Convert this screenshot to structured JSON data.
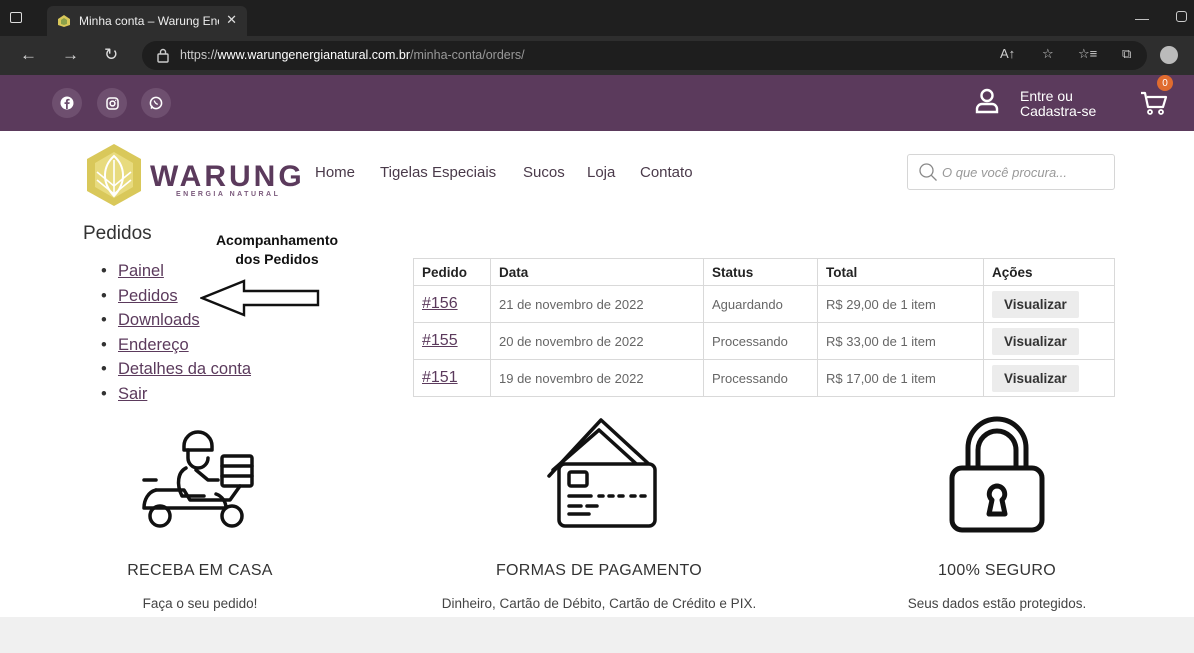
{
  "browser": {
    "tab_title": "Minha conta – Warung Energia N",
    "url_scheme": "https://",
    "url_host": "www.warungenergianatural.com.br",
    "url_path": "/minha-conta/orders/"
  },
  "topbar": {
    "account_line1": "Entre ou",
    "account_line2": "Cadastra-se",
    "cart_count": "0"
  },
  "brand": {
    "name": "WARUNG",
    "tagline": "ENERGIA NATURAL"
  },
  "nav": {
    "items": [
      "Home",
      "Tigelas Especiais",
      "Sucos",
      "Loja",
      "Contato"
    ]
  },
  "search": {
    "placeholder": "O que você procura..."
  },
  "account": {
    "section_title": "Pedidos",
    "annotation_line1": "Acompanhamento",
    "annotation_line2": "dos Pedidos",
    "menu": [
      "Painel",
      "Pedidos",
      "Downloads",
      "Endereço",
      "Detalhes da conta",
      "Sair"
    ]
  },
  "orders": {
    "headers": [
      "Pedido",
      "Data",
      "Status",
      "Total",
      "Ações"
    ],
    "rows": [
      {
        "number": "#156",
        "date": "21 de novembro de 2022",
        "status": "Aguardando",
        "total": "R$ 29,00 de 1 item",
        "action": "Visualizar"
      },
      {
        "number": "#155",
        "date": "20 de novembro de 2022",
        "status": "Processando",
        "total": "R$ 33,00 de 1 item",
        "action": "Visualizar"
      },
      {
        "number": "#151",
        "date": "19 de novembro de 2022",
        "status": "Processando",
        "total": "R$ 17,00 de 1 item",
        "action": "Visualizar"
      }
    ]
  },
  "features": [
    {
      "title": "RECEBA EM CASA",
      "desc": "Faça o seu pedido!",
      "icon": "delivery-scooter-icon"
    },
    {
      "title": "FORMAS DE PAGAMENTO",
      "desc": "Dinheiro, Cartão de Débito, Cartão de Crédito e PIX.",
      "icon": "credit-card-icon"
    },
    {
      "title": "100% SEGURO",
      "desc": "Seus dados estão protegidos.",
      "icon": "padlock-icon"
    }
  ],
  "colors": {
    "brand_purple": "#5b3a5c",
    "logo_yellow": "#d9c85a",
    "cart_badge": "#e06c2f"
  }
}
